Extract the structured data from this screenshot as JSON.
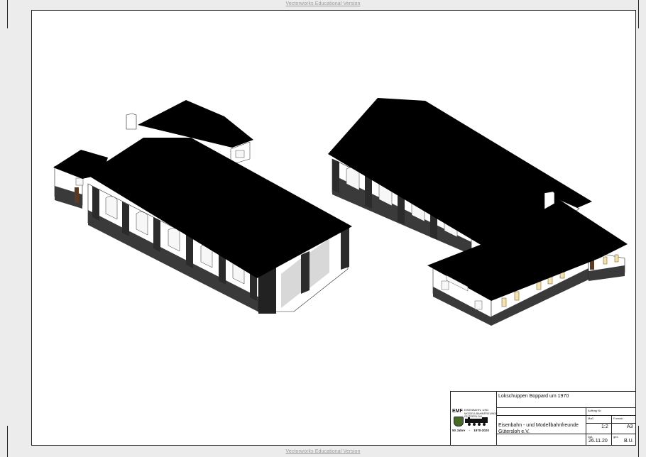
{
  "watermark": {
    "top": "Vectorworks Educational Version",
    "bottom": "Vectorworks Educational Version"
  },
  "titleblock": {
    "title": "Lokschuppen Boppard um 1970",
    "auftrag_label": "Auftrag Nr.",
    "auftrag_value": "",
    "club_line1": "Eisenbahn - und Modellbahnfreunde",
    "club_line2": "Gütersloh e.V.",
    "mass_label": "Maß",
    "mass_value": "1:2",
    "format_label": "Format:",
    "format_value": "A3",
    "datum_label": "Dat.",
    "datum_value": "26.11.20",
    "gez_label": "gez.",
    "gez_value": "B.U.",
    "logo_abbr": "EMF",
    "logo_text": "EISENBAHN- UND MODELLBAHNFREUNDE GÜTERSLOH",
    "jubilee_left": "50 Jahre",
    "jubilee_sep": "-",
    "jubilee_right": "1970-2020"
  },
  "colors": {
    "roof": "#000000",
    "wall": "#ffffff",
    "base": "#3a3a3a",
    "window": "#f7f7f7",
    "frame": "#222222"
  }
}
